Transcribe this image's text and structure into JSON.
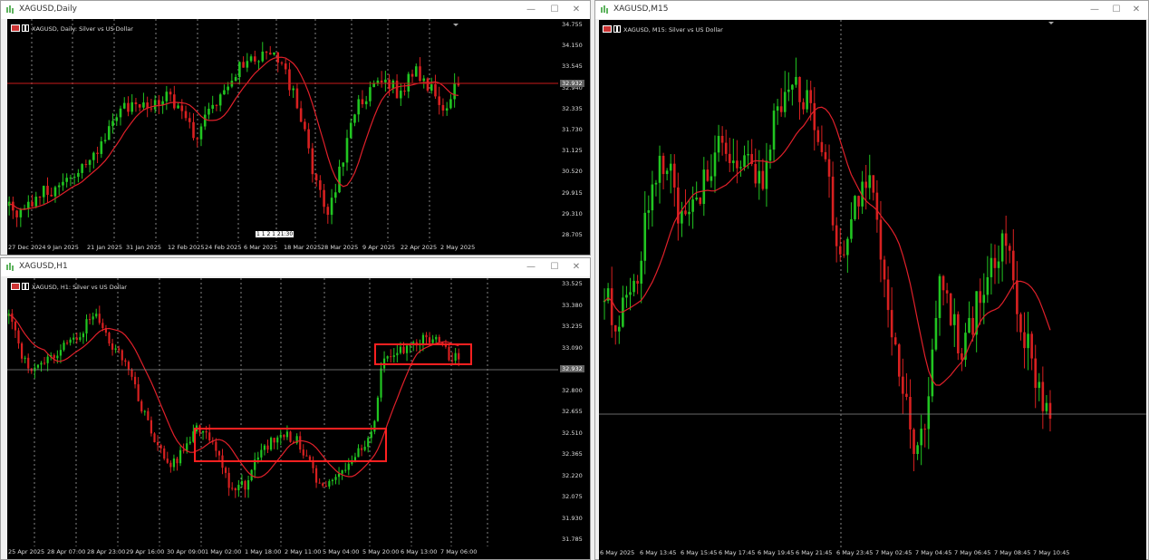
{
  "colors": {
    "bull": "#21c521",
    "bear": "#d82020",
    "ma": "#e0202a",
    "grid": "#bdbdbd",
    "box": "#ff2020",
    "hline": "#c81a1a"
  },
  "windows": {
    "daily": {
      "title": "XAGUSD,Daily",
      "symbol_label": "XAGUSD, Daily:  Silver vs US Dollar",
      "price_labels": [
        "34.755",
        "34.150",
        "33.545",
        "32.940",
        "32.335",
        "31.730",
        "31.125",
        "30.520",
        "29.915",
        "29.310",
        "28.705"
      ],
      "price_badge": "32.932",
      "time_labels": [
        "27 Dec 2024",
        "9 Jan 2025",
        "21 Jan 2025",
        "31 Jan 2025",
        "12 Feb 2025",
        "24 Feb 2025",
        "6 Mar 2025",
        "18 Mar 2025",
        "28 Mar 2025",
        "9 Apr 2025",
        "22 Apr 2025",
        "2 May 2025"
      ],
      "countdown": "1 1 2 1 21:30"
    },
    "h1": {
      "title": "XAGUSD,H1",
      "symbol_label": "XAGUSD, H1:  Silver vs US Dollar",
      "price_labels": [
        "33.525",
        "33.380",
        "33.235",
        "33.090",
        "32.945",
        "32.800",
        "32.655",
        "32.510",
        "32.365",
        "32.220",
        "32.075",
        "31.930",
        "31.785"
      ],
      "price_badge": "32.932",
      "time_labels": [
        "25 Apr 2025",
        "28 Apr 07:00",
        "28 Apr 23:00",
        "29 Apr 16:00",
        "30 Apr 09:00",
        "1 May 02:00",
        "1 May 18:00",
        "2 May 11:00",
        "5 May 04:00",
        "5 May 20:00",
        "6 May 13:00",
        "7 May 06:00"
      ]
    },
    "m15": {
      "title": "XAGUSD,M15",
      "symbol_label": "XAGUSD, M15:  Silver vs US Dollar",
      "time_labels": [
        "6 May 2025",
        "6 May 13:45",
        "6 May 15:45",
        "6 May 17:45",
        "6 May 19:45",
        "6 May 21:45",
        "6 May 23:45",
        "7 May 02:45",
        "7 May 04:45",
        "7 May 06:45",
        "7 May 08:45",
        "7 May 10:45"
      ]
    }
  },
  "window_buttons": {
    "minimize": "—",
    "maximize": "☐",
    "close": "✕"
  }
}
